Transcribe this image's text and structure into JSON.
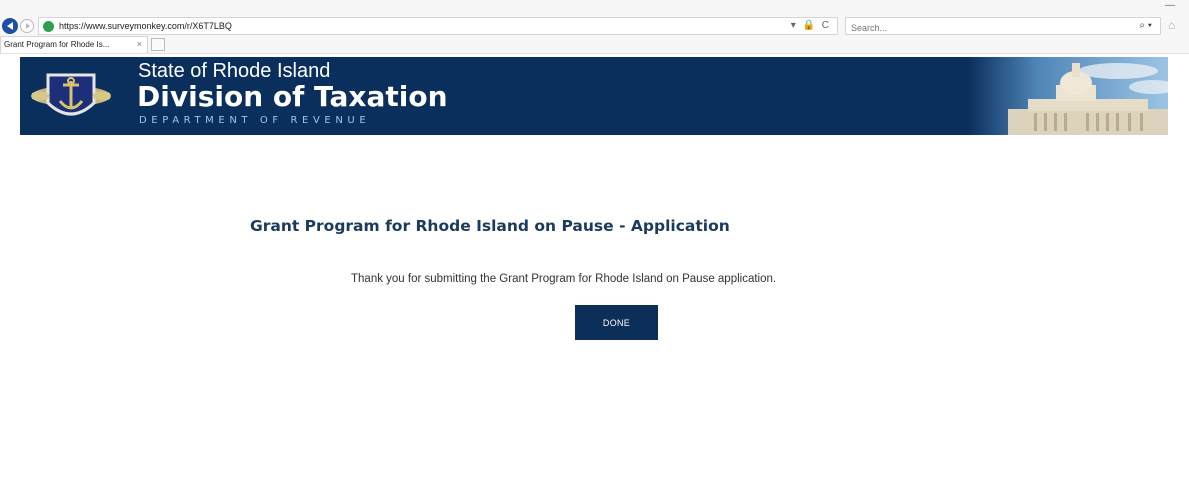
{
  "browser": {
    "url": "https://www.surveymonkey.com/r/X6T7LBQ",
    "search_placeholder": "Search...",
    "search_icon_glyph": "⌕ ▾",
    "addr_icons": "▾ 🔒 C",
    "tab_title": "Grant Program for Rhode Is...",
    "tab_close": "×",
    "window_minimize": "—"
  },
  "banner": {
    "line1": "State of Rhode Island",
    "line2": "Division of Taxation",
    "line3": "DEPARTMENT OF REVENUE",
    "background_color": "#0b2f5c"
  },
  "survey": {
    "title": "Grant Program for Rhode Island on Pause - Application",
    "message": "Thank you for submitting the Grant Program for Rhode Island on Pause application.",
    "done_label": "DONE",
    "accent_color": "#0c2f5a"
  }
}
